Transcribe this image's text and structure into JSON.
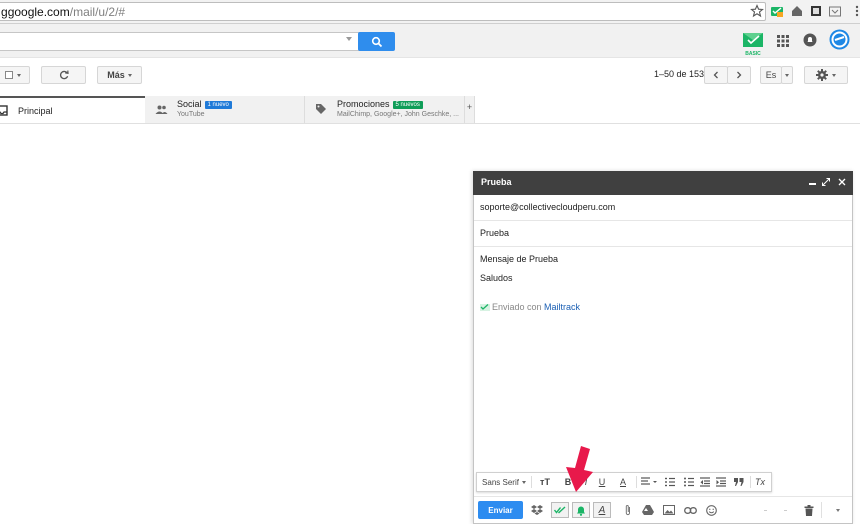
{
  "browser": {
    "url_host": "google.com",
    "url_path": "/mail/u/2/#",
    "url_prefix": "g"
  },
  "header": {
    "mailtrack_badge": "BASIC"
  },
  "toolbar": {
    "more_label": "Más",
    "pager": "1–50 de 153",
    "language": "Es"
  },
  "tabs": [
    {
      "title": "Principal",
      "sub": "",
      "badge": ""
    },
    {
      "title": "Social",
      "sub": "YouTube",
      "badge": "1 nuevo"
    },
    {
      "title": "Promociones",
      "sub": "MailChimp, Google+, John Geschke, ...",
      "badge": "5 nuevos"
    }
  ],
  "add_tab": "+",
  "compose": {
    "title": "Prueba",
    "to": "soporte@collectivecloudperu.com",
    "subject": "Prueba",
    "body_line1": "Mensaje de Prueba",
    "body_line2": "Saludos",
    "sig_prefix": "Enviado con ",
    "sig_link": "Mailtrack",
    "send_label": "Enviar",
    "font": "Sans Serif"
  },
  "colors": {
    "accent_blue": "#2d8cf0",
    "social_badge": "#1f7ad8",
    "promo_badge": "#0f9d58",
    "mailtrack_green": "#1bb566",
    "arrow_red": "#e8194b",
    "compose_head": "#404040"
  }
}
